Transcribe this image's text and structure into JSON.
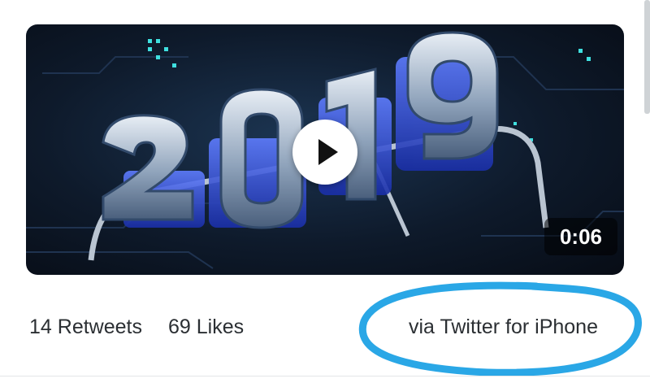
{
  "video": {
    "duration": "0:06",
    "artwork_text": "2019",
    "play_icon": "play-icon"
  },
  "stats": {
    "retweets_count": "14",
    "retweets_label": "Retweets",
    "likes_count": "69",
    "likes_label": "Likes"
  },
  "source": {
    "text": "via Twitter for iPhone"
  },
  "colors": {
    "annotation_circle": "#2aa7e6",
    "text": "#2b2f33",
    "badge_bg": "rgba(0,0,0,0.55)"
  }
}
